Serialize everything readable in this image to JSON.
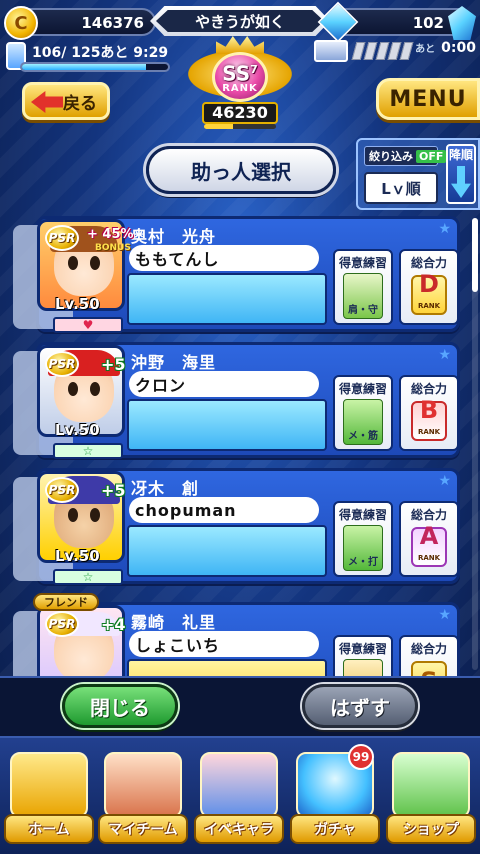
{
  "header": {
    "coins": "146376",
    "team_name": "やきうが如く",
    "gems": "102",
    "stamina_text": "106/ 125あと  9:29",
    "stamina_fraction": 0.848,
    "rank_tier": "SS",
    "rank_tier_sup": "7",
    "rank_label": "RANK",
    "rank_score": "46230",
    "ticket_prefix": "あと",
    "ticket_time": "0:00",
    "back_label": "戻る",
    "menu_label": "MENU"
  },
  "panel": {
    "title": "助っ人選択",
    "filter_label": "絞り込み",
    "filter_state": "OFF",
    "sort_value": "Lｖ順",
    "sort_order_label": "降順"
  },
  "stat_labels": {
    "practice": "得意練習",
    "overall": "総合力",
    "rank_word": "RANK"
  },
  "helpers": [
    {
      "name": "奥村　光舟",
      "owner": "ももてんし",
      "psr": "PSR",
      "bonus": "+ 45%",
      "bonus_sub": "BONUS",
      "level": "Lv.50",
      "practice": "肩・守",
      "rank": "D",
      "affinity": "♥"
    },
    {
      "name": "沖野　海里",
      "owner": "クロン",
      "psr": "PSR",
      "plus": "+5",
      "level": "Lv.50",
      "practice": "メ・筋",
      "rank": "B",
      "affinity": "☆"
    },
    {
      "name": "冴木　創",
      "owner": "chopuman",
      "psr": "PSR",
      "plus": "+5",
      "level": "Lv.50",
      "practice": "メ・打",
      "rank": "A",
      "affinity": "☆"
    },
    {
      "name": "霧崎　礼里",
      "owner": "しょこいち",
      "psr": "PSR",
      "plus": "+4",
      "friend_tag": "フレンド",
      "rank": "S"
    }
  ],
  "buttons": {
    "close": "閉じる",
    "remove": "はずす"
  },
  "nav": [
    {
      "label": "ホーム"
    },
    {
      "label": "マイチーム"
    },
    {
      "label": "イベキャラ"
    },
    {
      "label": "ガチャ",
      "badge": "99"
    },
    {
      "label": "ショップ"
    }
  ],
  "colors": {
    "accent_gold": "#e0a000",
    "card_blue": "#2f67e0",
    "close_green": "#1e9a2f"
  }
}
